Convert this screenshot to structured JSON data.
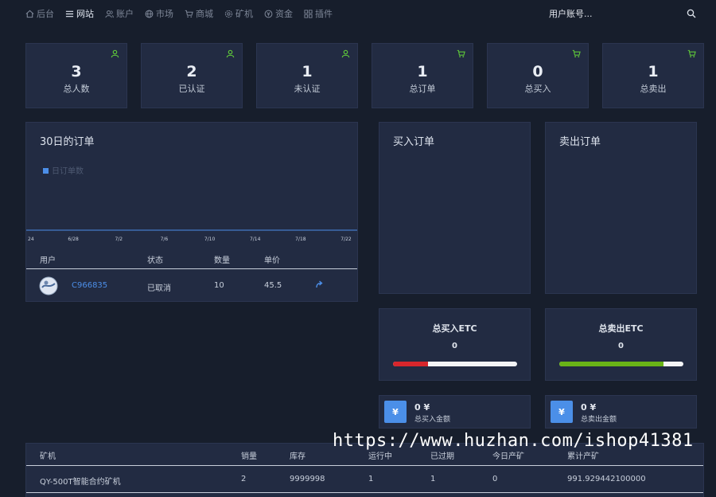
{
  "nav": {
    "items": [
      {
        "label": "后台",
        "icon": "home-icon"
      },
      {
        "label": "网站",
        "icon": "list-icon",
        "active": true
      },
      {
        "label": "账户",
        "icon": "users-icon"
      },
      {
        "label": "市场",
        "icon": "globe-icon"
      },
      {
        "label": "商城",
        "icon": "cart-icon"
      },
      {
        "label": "矿机",
        "icon": "gear-icon"
      },
      {
        "label": "资金",
        "icon": "coin-icon"
      },
      {
        "label": "插件",
        "icon": "grid-icon"
      }
    ],
    "search_placeholder": "用户账号..."
  },
  "stats": [
    {
      "value": "3",
      "label": "总人数",
      "icon": "user-icon"
    },
    {
      "value": "2",
      "label": "已认证",
      "icon": "user-icon"
    },
    {
      "value": "1",
      "label": "未认证",
      "icon": "user-icon"
    },
    {
      "value": "1",
      "label": "总订单",
      "icon": "cart-icon"
    },
    {
      "value": "0",
      "label": "总买入",
      "icon": "cart-icon"
    },
    {
      "value": "1",
      "label": "总卖出",
      "icon": "cart-icon"
    }
  ],
  "colors": {
    "accent": "#4c8ee8",
    "green_icon": "#5fc83a",
    "red_bar": "#d8262c",
    "green_bar": "#69b417"
  },
  "orders_panel": {
    "title": "30日的订单",
    "table": {
      "headers": [
        "用户",
        "状态",
        "数量",
        "单价"
      ],
      "rows": [
        {
          "user": "C966835",
          "status": "已取消",
          "qty": "10",
          "price": "45.5"
        }
      ]
    }
  },
  "chart_data": {
    "type": "line",
    "legend": [
      "日订单数"
    ],
    "legend_position": "top-left",
    "x": [
      "24",
      "6/28",
      "7/2",
      "7/6",
      "7/10",
      "7/14",
      "7/18",
      "7/22"
    ],
    "series": [
      {
        "name": "日订单数",
        "values": [
          0,
          0,
          0,
          0,
          0,
          0,
          0,
          0
        ]
      }
    ],
    "grid": false
  },
  "buy_panel": {
    "title": "买入订单"
  },
  "sell_panel": {
    "title": "卖出订单"
  },
  "buy_total": {
    "title": "总买入ETC",
    "value": "0",
    "progress": 0.28
  },
  "sell_total": {
    "title": "总卖出ETC",
    "value": "0",
    "progress": 0.84
  },
  "buy_money": {
    "currency": "¥",
    "value": "0 ¥",
    "label": "总买入金额"
  },
  "sell_money": {
    "currency": "¥",
    "value": "0 ¥",
    "label": "总卖出金额"
  },
  "miners": {
    "headers": [
      "矿机",
      "销量",
      "库存",
      "运行中",
      "已过期",
      "今日产矿",
      "累计产矿"
    ],
    "rows": [
      {
        "name": "QY-500T智能合约矿机",
        "sold": "2",
        "stock": "9999998",
        "running": "1",
        "expired": "1",
        "today": "0",
        "total": "991.929442100000"
      }
    ]
  },
  "watermark": "https://www.huzhan.com/ishop41381"
}
